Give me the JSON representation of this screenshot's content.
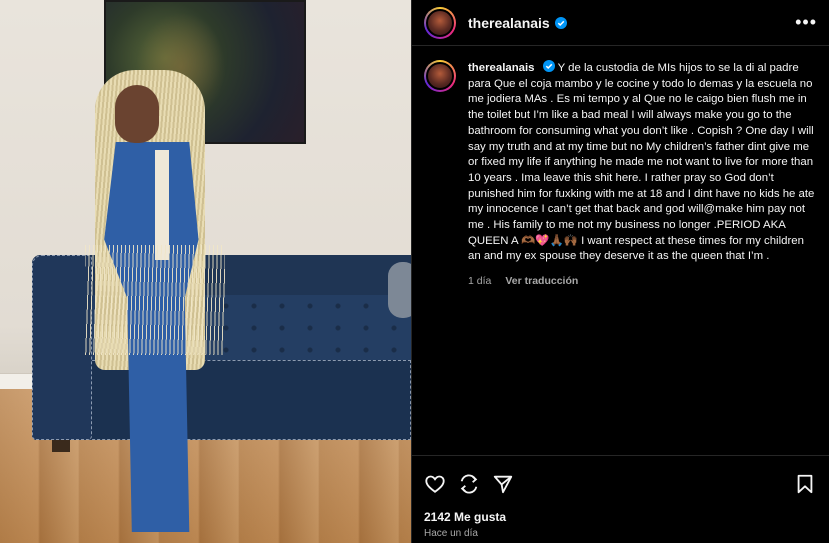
{
  "post": {
    "username": "therealanais",
    "verified_icon": "verified-badge-icon",
    "more_icon": "more-options-icon",
    "more_label": "•••"
  },
  "caption": {
    "username": "therealanais",
    "text": " Y de la custodia de MIs hijos to se la di al padre para Que el coja mambo y le cocine y todo lo demas y la escuela no me jodiera MAs . Es mi tempo y al Que no le caigo bien flush me in the toilet but I’m like a bad meal I will always make you go to the bathroom for consuming what you don’t like . Copish ? One day I will say my truth and at my time but no My children’s father dint give me or fixed my life if anything he made me not want to live for more than 10 years . Ima leave this shit here. I rather pray so God don’t punished him for fuxking with me at 18 and I dint have no kids he ate my innocence I can’t get that back and god will@make him pay not me . His family to me not my business no longer .PERIOD AKA QUEEN A 🫶🏾💖🙏🏾🙌🏾 I want respect at these times for my children an and my ex spouse they deserve it as the queen that I’m .",
    "time": "1 día",
    "translate_label": "Ver traducción"
  },
  "footer": {
    "likes": "2142 Me gusta",
    "ago": "Hace un día"
  },
  "colors": {
    "background": "#000000",
    "text": "#f5f5f5",
    "secondary": "#a8a8a8",
    "verified": "#0095f6",
    "divider": "#262626"
  },
  "icons": [
    "heart-icon",
    "comment-icon",
    "share-icon",
    "bookmark-icon"
  ]
}
